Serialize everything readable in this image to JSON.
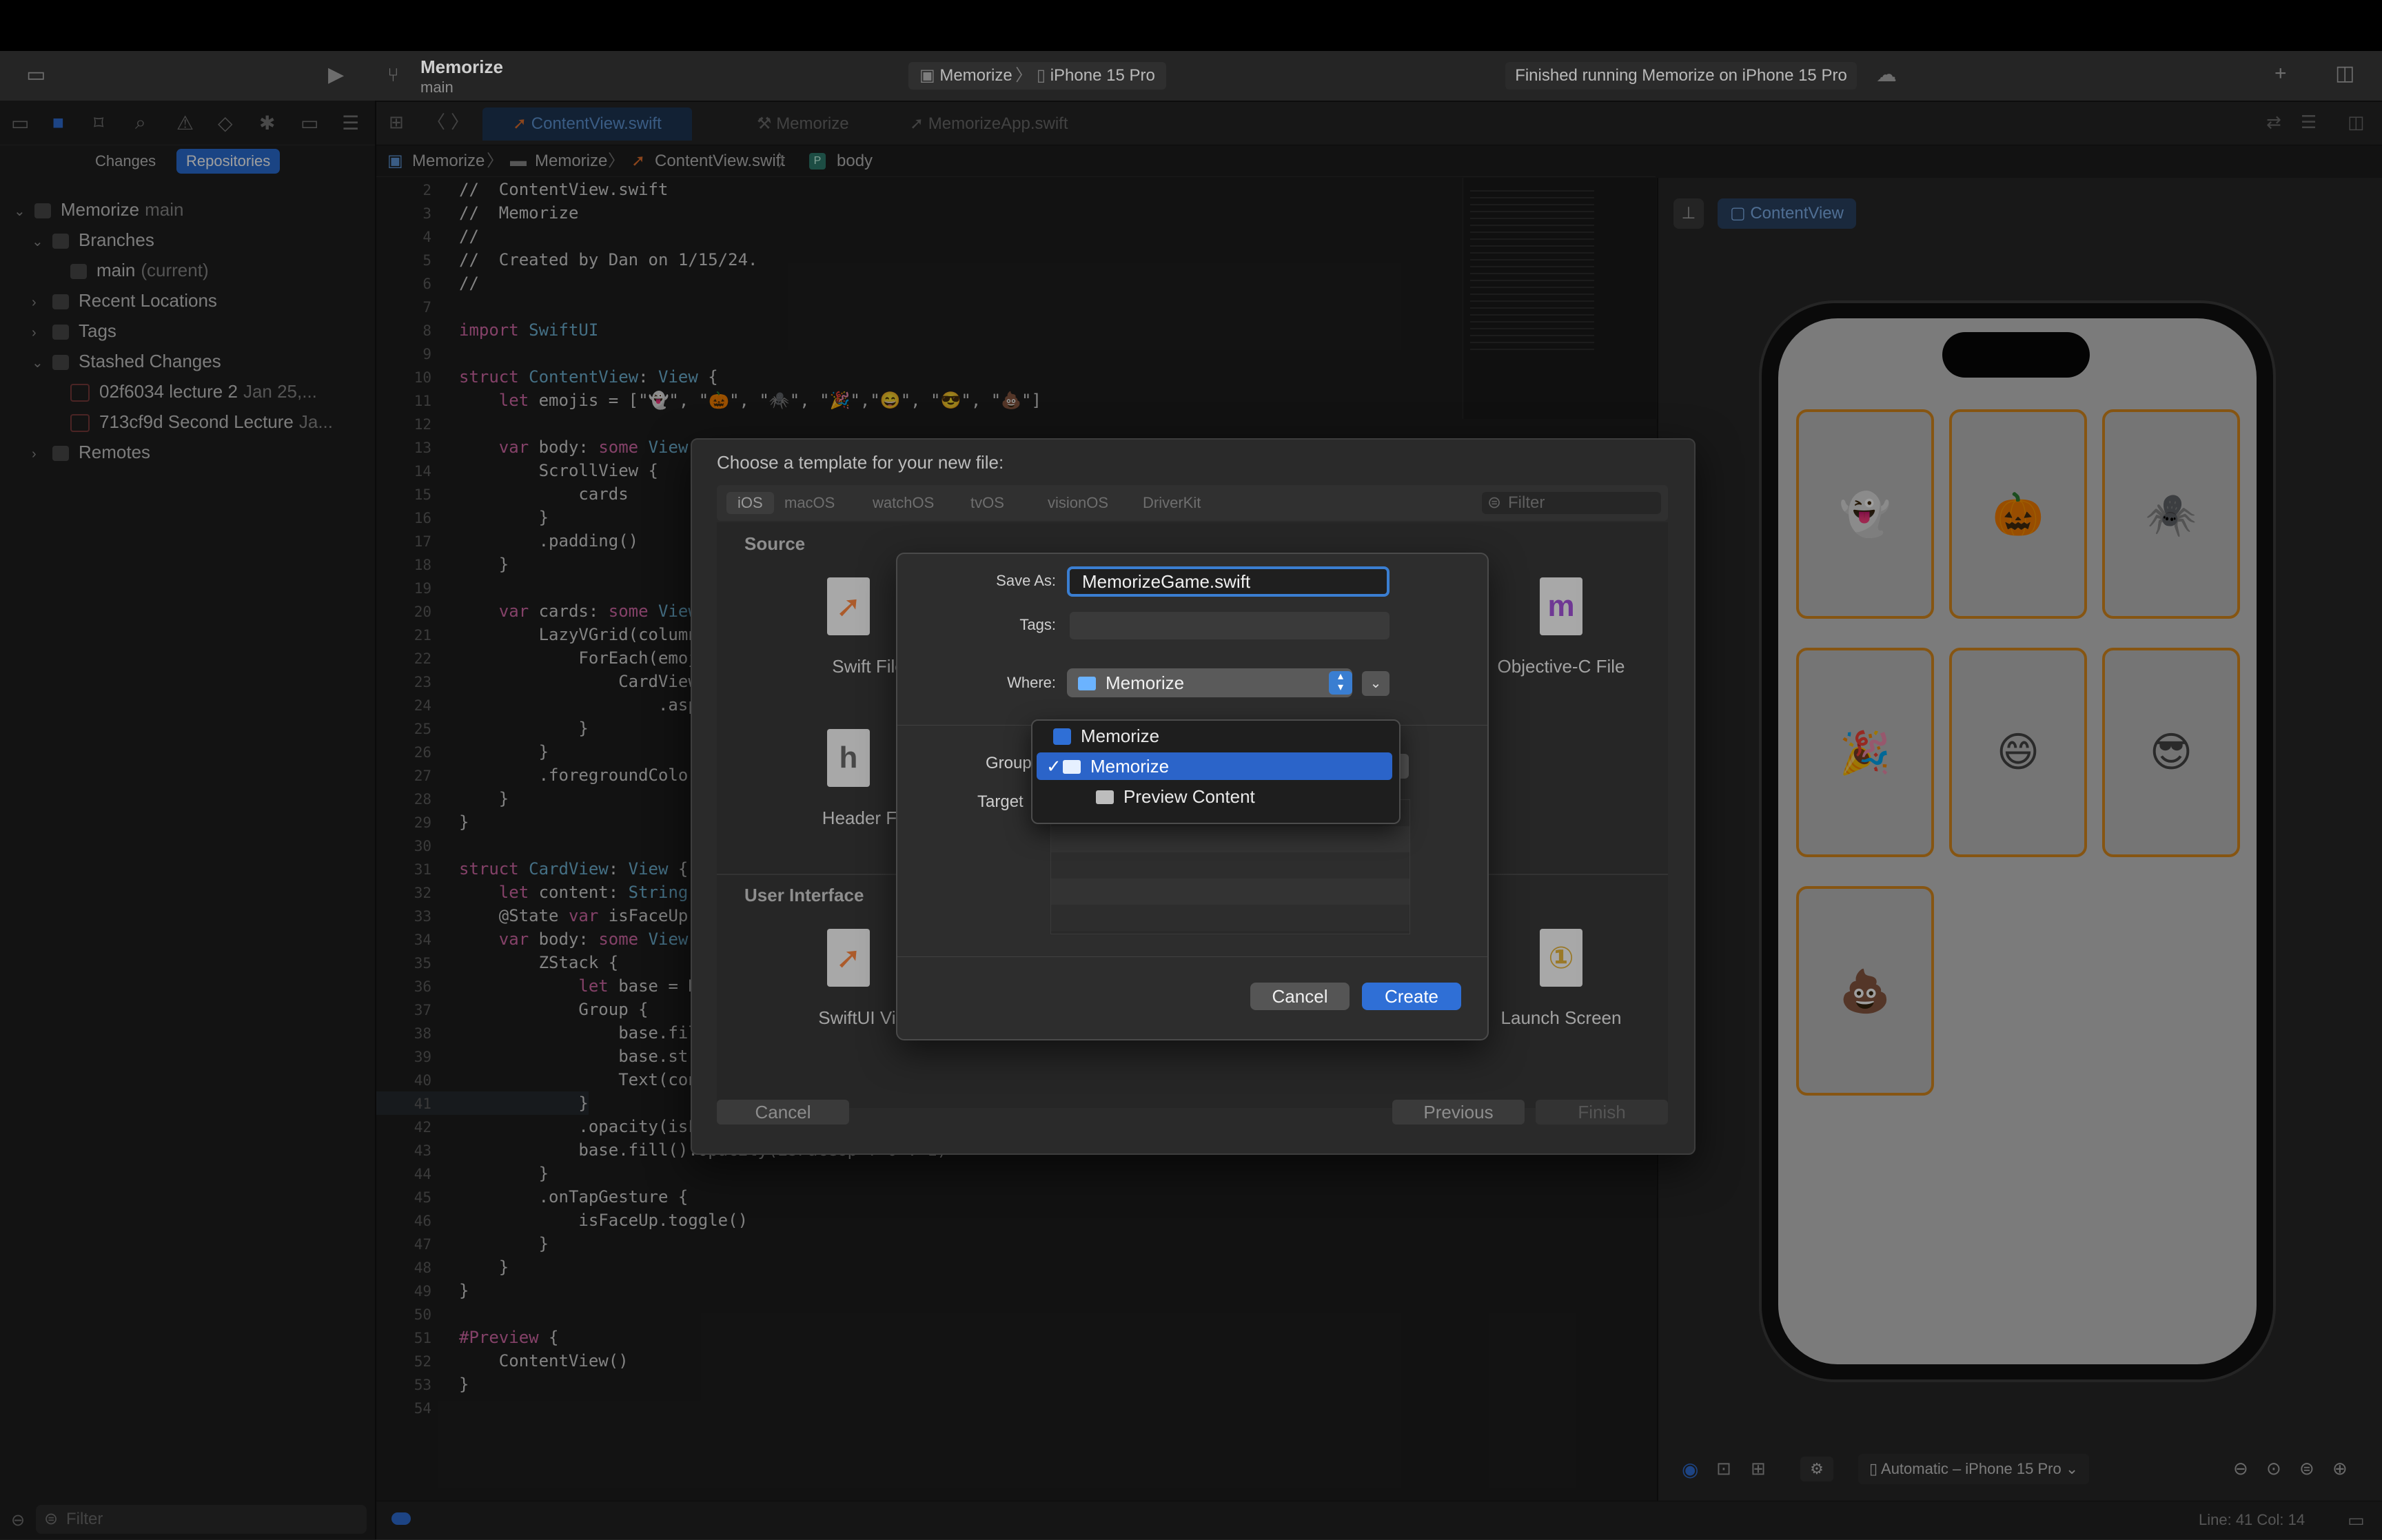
{
  "toolbar": {
    "project_name": "Memorize",
    "branch": "main",
    "scheme": "Memorize",
    "destination": "iPhone 15 Pro",
    "status": "Finished running Memorize on iPhone 15 Pro"
  },
  "navigator": {
    "segments": [
      "Changes",
      "Repositories"
    ],
    "tree": [
      {
        "label": "Memorize",
        "sub": "main",
        "level": 0,
        "expanded": true
      },
      {
        "label": "Branches",
        "sub": "",
        "level": 1,
        "expanded": true
      },
      {
        "label": "main",
        "sub": "(current)",
        "level": 2,
        "expanded": null
      },
      {
        "label": "Recent Locations",
        "sub": "",
        "level": 1,
        "expanded": false
      },
      {
        "label": "Tags",
        "sub": "",
        "level": 1,
        "expanded": false
      },
      {
        "label": "Stashed Changes",
        "sub": "",
        "level": 1,
        "expanded": true
      },
      {
        "label": "02f6034 lecture 2",
        "sub": "Jan 25,...",
        "level": 2,
        "expanded": null
      },
      {
        "label": "713cf9d Second Lecture",
        "sub": "Ja...",
        "level": 2,
        "expanded": null
      },
      {
        "label": "Remotes",
        "sub": "",
        "level": 1,
        "expanded": false
      }
    ],
    "filter_placeholder": "Filter"
  },
  "editor": {
    "tabs": [
      "ContentView.swift",
      "Memorize",
      "MemorizeApp.swift"
    ],
    "jumpbar": [
      "Memorize",
      "Memorize",
      "ContentView.swift",
      "body"
    ],
    "code": [
      {
        "n": "2",
        "t": "//  ContentView.swift",
        "k": "cm"
      },
      {
        "n": "3",
        "t": "//  Memorize",
        "k": "cm"
      },
      {
        "n": "4",
        "t": "//",
        "k": "cm"
      },
      {
        "n": "5",
        "t": "//  Created by Dan on 1/15/24.",
        "k": "cm"
      },
      {
        "n": "6",
        "t": "//",
        "k": "cm"
      },
      {
        "n": "7",
        "t": "",
        "k": ""
      },
      {
        "n": "8",
        "t": "import SwiftUI",
        "k": "import"
      },
      {
        "n": "9",
        "t": "",
        "k": ""
      },
      {
        "n": "10",
        "t": "struct ContentView: View {",
        "k": "struct"
      },
      {
        "n": "11",
        "t": "    let emojis = [\"👻\", \"🎃\", \"🕷️\", \"🎉\",\"😄\", \"😎\", \"💩\"]",
        "k": "let"
      },
      {
        "n": "12",
        "t": "",
        "k": ""
      },
      {
        "n": "13",
        "t": "    var body: some View",
        "k": "var"
      },
      {
        "n": "14",
        "t": "        ScrollView {",
        "k": ""
      },
      {
        "n": "15",
        "t": "            cards",
        "k": ""
      },
      {
        "n": "16",
        "t": "        }",
        "k": ""
      },
      {
        "n": "17",
        "t": "        .padding()",
        "k": ""
      },
      {
        "n": "18",
        "t": "    }",
        "k": ""
      },
      {
        "n": "19",
        "t": "",
        "k": ""
      },
      {
        "n": "20",
        "t": "    var cards: some View",
        "k": "var"
      },
      {
        "n": "21",
        "t": "        LazyVGrid(column",
        "k": ""
      },
      {
        "n": "22",
        "t": "            ForEach(emoj",
        "k": ""
      },
      {
        "n": "23",
        "t": "                CardView",
        "k": ""
      },
      {
        "n": "24",
        "t": "                    .asp",
        "k": ""
      },
      {
        "n": "25",
        "t": "            }",
        "k": ""
      },
      {
        "n": "26",
        "t": "        }",
        "k": ""
      },
      {
        "n": "27",
        "t": "        .foregroundColor",
        "k": ""
      },
      {
        "n": "28",
        "t": "    }",
        "k": ""
      },
      {
        "n": "29",
        "t": "}",
        "k": ""
      },
      {
        "n": "30",
        "t": "",
        "k": ""
      },
      {
        "n": "31",
        "t": "struct CardView: View {",
        "k": "struct"
      },
      {
        "n": "32",
        "t": "    let content: String",
        "k": "let"
      },
      {
        "n": "33",
        "t": "    @State var isFaceUp",
        "k": "var"
      },
      {
        "n": "34",
        "t": "    var body: some View",
        "k": "var"
      },
      {
        "n": "35",
        "t": "        ZStack {",
        "k": ""
      },
      {
        "n": "36",
        "t": "            let base = R",
        "k": "let"
      },
      {
        "n": "37",
        "t": "            Group {",
        "k": ""
      },
      {
        "n": "38",
        "t": "                base.fil",
        "k": ""
      },
      {
        "n": "39",
        "t": "                base.str",
        "k": ""
      },
      {
        "n": "40",
        "t": "                Text(con",
        "k": ""
      },
      {
        "n": "41",
        "t": "            }",
        "k": ""
      },
      {
        "n": "42",
        "t": "            .opacity(isF",
        "k": ""
      },
      {
        "n": "43",
        "t": "            base.fill().opacity(isFaceUp ? 0 : 1)",
        "k": ""
      },
      {
        "n": "44",
        "t": "        }",
        "k": ""
      },
      {
        "n": "45",
        "t": "        .onTapGesture {",
        "k": ""
      },
      {
        "n": "46",
        "t": "            isFaceUp.toggle()",
        "k": ""
      },
      {
        "n": "47",
        "t": "        }",
        "k": ""
      },
      {
        "n": "48",
        "t": "    }",
        "k": ""
      },
      {
        "n": "49",
        "t": "}",
        "k": ""
      },
      {
        "n": "50",
        "t": "",
        "k": ""
      },
      {
        "n": "51",
        "t": "#Preview {",
        "k": "preview"
      },
      {
        "n": "52",
        "t": "    ContentView()",
        "k": ""
      },
      {
        "n": "53",
        "t": "}",
        "k": ""
      },
      {
        "n": "54",
        "t": "",
        "k": ""
      }
    ]
  },
  "preview": {
    "pin_label": "ContentView",
    "cards": [
      "👻",
      "🎃",
      "🕷️",
      "🎉",
      "😄",
      "😎",
      "💩"
    ],
    "device_menu": "Automatic – iPhone 15 Pro"
  },
  "status_bar": {
    "position": "Line: 41  Col: 14"
  },
  "template_sheet": {
    "title": "Choose a template for your new file:",
    "platforms": [
      "iOS",
      "macOS",
      "watchOS",
      "tvOS",
      "visionOS",
      "DriverKit"
    ],
    "filter_placeholder": "Filter",
    "sections": {
      "source": "Source",
      "user_interface": "User Interface"
    },
    "templates": {
      "swift_file": "Swift File",
      "objc_file": "Objective-C File",
      "header_file": "Header File",
      "swiftui_view": "SwiftUI View",
      "launch_screen": "Launch Screen"
    },
    "cancel": "Cancel",
    "previous": "Previous",
    "finish": "Finish"
  },
  "save_dialog": {
    "save_as_label": "Save As:",
    "save_as_value": "MemorizeGame.swift",
    "tags_label": "Tags:",
    "where_label": "Where:",
    "where_value": "Memorize",
    "group_label": "Group",
    "targets_label": "Target",
    "cancel": "Cancel",
    "create": "Create"
  },
  "group_popup": {
    "items": [
      "Memorize",
      "Memorize",
      "Preview Content"
    ],
    "selected": "Memorize"
  },
  "colors": {
    "accent": "#2f6fd6",
    "card_border": "#d88a1e"
  }
}
